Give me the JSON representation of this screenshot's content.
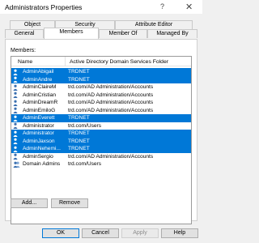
{
  "window": {
    "title": "Administrators Properties",
    "help_glyph": "?",
    "close_glyph": "✕"
  },
  "tabs": {
    "top": [
      "Object",
      "Security",
      "Attribute Editor"
    ],
    "bottom": [
      "General",
      "Members",
      "Member Of",
      "Managed By"
    ],
    "active": "Members"
  },
  "members": {
    "label": "Members:",
    "columns": [
      "Name",
      "Active Directory Domain Services Folder"
    ],
    "rows": [
      {
        "name": "AdminAbigail",
        "folder": "TRDNET",
        "selected": true,
        "icon": "user-icon"
      },
      {
        "name": "AdminAndre",
        "folder": "TRDNET",
        "selected": true,
        "icon": "user-icon"
      },
      {
        "name": "AdminClaireM",
        "folder": "trd.com/AD Administration/Accounts",
        "selected": false,
        "icon": "user-icon"
      },
      {
        "name": "AdminCristian",
        "folder": "trd.com/AD Administration/Accounts",
        "selected": false,
        "icon": "user-icon"
      },
      {
        "name": "AdminDreamR",
        "folder": "trd.com/AD Administration/Accounts",
        "selected": false,
        "icon": "user-icon"
      },
      {
        "name": "AdminEmiloG",
        "folder": "trd.com/AD Administration/Accounts",
        "selected": false,
        "icon": "user-icon"
      },
      {
        "name": "AdminEverett",
        "folder": "TRDNET",
        "selected": true,
        "icon": "user-icon"
      },
      {
        "name": "Administrator",
        "folder": "trd.com/Users",
        "selected": false,
        "icon": "user-icon"
      },
      {
        "name": "Administrator",
        "folder": "TRDNET",
        "selected": true,
        "icon": "user-icon"
      },
      {
        "name": "AdminJaxson",
        "folder": "TRDNET",
        "selected": true,
        "icon": "user-icon"
      },
      {
        "name": "AdminNehemi...",
        "folder": "TRDNET",
        "selected": true,
        "icon": "user-icon"
      },
      {
        "name": "AdminSergio",
        "folder": "trd.com/AD Administration/Accounts",
        "selected": false,
        "icon": "user-icon"
      },
      {
        "name": "Domain Admins",
        "folder": "trd.com/Users",
        "selected": false,
        "icon": "group-icon"
      }
    ]
  },
  "actions": {
    "add": "Add...",
    "remove": "Remove"
  },
  "dialog_buttons": {
    "ok": "OK",
    "cancel": "Cancel",
    "apply": "Apply",
    "help": "Help"
  },
  "colors": {
    "selection": "#0078d7",
    "selection_text": "#ffffff"
  }
}
